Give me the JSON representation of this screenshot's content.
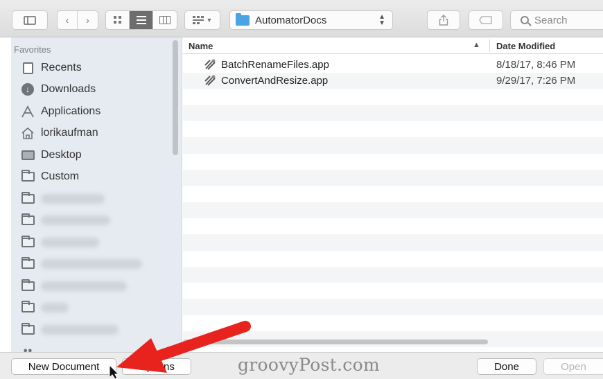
{
  "toolbar": {
    "sidebar_toggle_icon": "sidebar-icon",
    "back_icon": "chevron-left-icon",
    "forward_icon": "chevron-right-icon",
    "view_modes": [
      "icon-view-icon",
      "list-view-icon",
      "column-view-icon"
    ],
    "active_view": "list-view-icon",
    "arrange_icon": "arrange-icon",
    "location": "AutomatorDocs",
    "search_placeholder": "Search"
  },
  "sidebar": {
    "section_title": "Favorites",
    "items": [
      {
        "label": "Recents",
        "icon": "recents-icon"
      },
      {
        "label": "Downloads",
        "icon": "downloads-icon"
      },
      {
        "label": "Applications",
        "icon": "applications-icon"
      },
      {
        "label": "lorikaufman",
        "icon": "home-icon"
      },
      {
        "label": "Desktop",
        "icon": "desktop-icon"
      },
      {
        "label": "Custom",
        "icon": "folder-icon"
      }
    ]
  },
  "file_list": {
    "columns": {
      "name": "Name",
      "date": "Date Modified"
    },
    "files": [
      {
        "name": "BatchRenameFiles.app",
        "date": "8/18/17, 8:46 PM"
      },
      {
        "name": "ConvertAndResize.app",
        "date": "9/29/17, 7:26 PM"
      }
    ]
  },
  "bottom_bar": {
    "new_document": "New Document",
    "options": "Options",
    "done": "Done",
    "open": "Open",
    "watermark": "groovyPost.com"
  },
  "colors": {
    "arrow": "#e8231e",
    "sidebar_bg": "#e6ebf1",
    "folder_accent": "#4aa4e3"
  }
}
